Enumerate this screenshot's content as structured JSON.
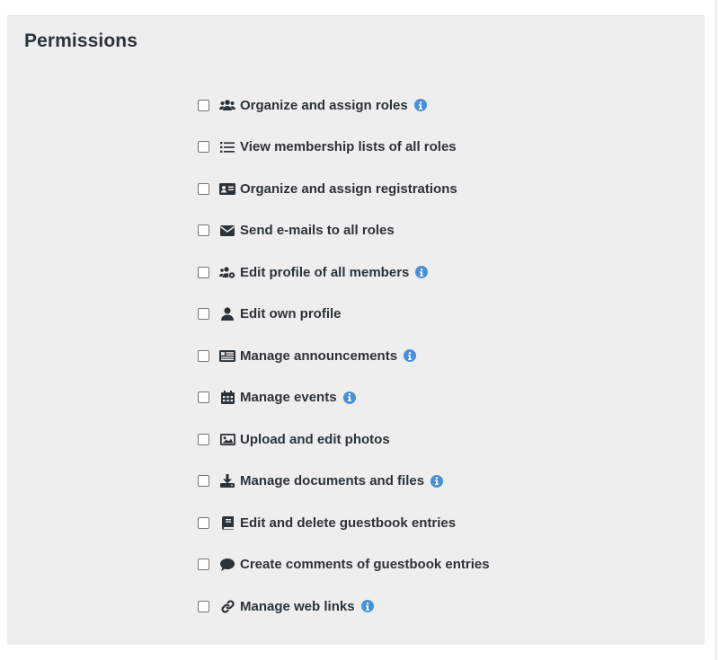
{
  "permissions": {
    "title": "Permissions",
    "items": [
      {
        "label": "Organize and assign roles",
        "icon": "users-icon",
        "info": true
      },
      {
        "label": "View membership lists of all roles",
        "icon": "list-icon",
        "info": false
      },
      {
        "label": "Organize and assign registrations",
        "icon": "id-card-icon",
        "info": false
      },
      {
        "label": "Send e-mails to all roles",
        "icon": "envelope-icon",
        "info": false
      },
      {
        "label": "Edit profile of all members",
        "icon": "users-cog-icon",
        "info": true
      },
      {
        "label": "Edit own profile",
        "icon": "user-icon",
        "info": false
      },
      {
        "label": "Manage announcements",
        "icon": "newspaper-icon",
        "info": true
      },
      {
        "label": "Manage events",
        "icon": "calendar-icon",
        "info": true
      },
      {
        "label": "Upload and edit photos",
        "icon": "image-icon",
        "info": false
      },
      {
        "label": "Manage documents and files",
        "icon": "download-icon",
        "info": true
      },
      {
        "label": "Edit and delete guestbook entries",
        "icon": "book-icon",
        "info": false
      },
      {
        "label": "Create comments of guestbook entries",
        "icon": "comment-icon",
        "info": false
      },
      {
        "label": "Manage web links",
        "icon": "link-icon",
        "info": true
      }
    ]
  },
  "colors": {
    "panel_bg": "#eeeeee",
    "text": "#2c3338",
    "info_accent": "#4a90d9"
  }
}
